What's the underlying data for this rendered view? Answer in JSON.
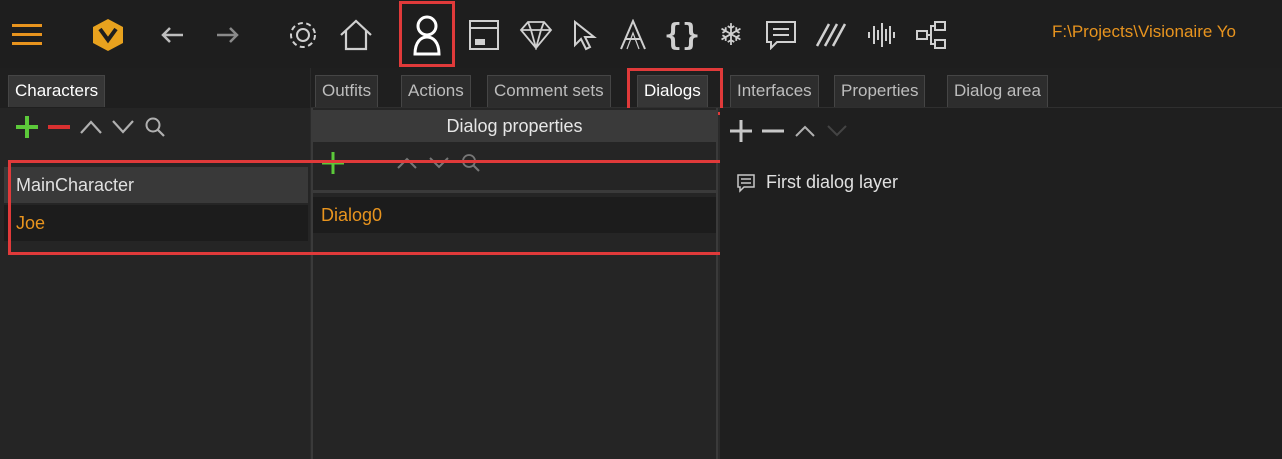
{
  "toolbar": {
    "buttons": [
      {
        "name": "menu-icon"
      },
      {
        "name": "logo-icon"
      },
      {
        "name": "back-arrow-icon"
      },
      {
        "name": "forward-arrow-icon"
      },
      {
        "name": "settings-gear-icon"
      },
      {
        "name": "home-icon"
      },
      {
        "name": "characters-icon"
      },
      {
        "name": "interfaces-window-icon"
      },
      {
        "name": "gem-icon"
      },
      {
        "name": "cursor-icon"
      },
      {
        "name": "font-icon"
      },
      {
        "name": "script-braces-icon"
      },
      {
        "name": "particles-snowflake-icon"
      },
      {
        "name": "comment-icon"
      },
      {
        "name": "shaders-icon"
      },
      {
        "name": "audio-waveform-icon"
      },
      {
        "name": "hierarchy-icon"
      }
    ],
    "project_path": "F:\\Projects\\Visionaire Yo"
  },
  "left_panel": {
    "tab": "Characters",
    "characters": [
      {
        "label": "MainCharacter",
        "selected": false
      },
      {
        "label": "Joe",
        "selected": true
      }
    ]
  },
  "main_tabs": [
    "Outfits",
    "Actions",
    "Comment sets",
    "Dialogs",
    "Interfaces",
    "Properties",
    "Dialog area"
  ],
  "active_tab": "Dialogs",
  "dialogs_panel": {
    "header": "Dialog properties",
    "items": [
      "Dialog0"
    ]
  },
  "dialog_layers": {
    "items": [
      "First dialog layer"
    ]
  },
  "colors": {
    "accent_orange": "#e8941e",
    "highlight_red": "#e03a3a",
    "add_green": "#5cc93a",
    "remove_red": "#d93030"
  }
}
